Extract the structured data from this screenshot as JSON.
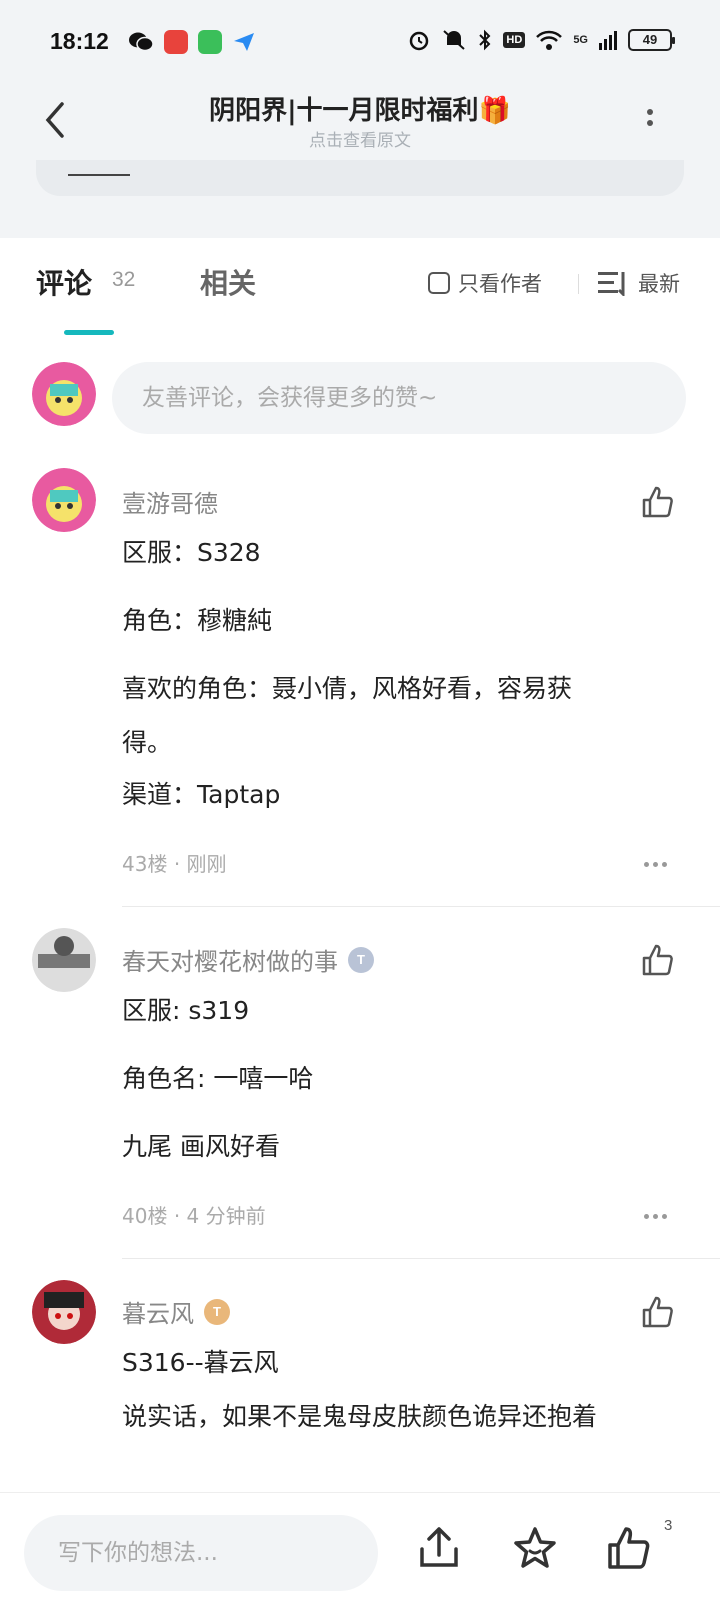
{
  "status_bar": {
    "time": "18:12",
    "battery": "49",
    "hd": "HD",
    "network": "5G"
  },
  "header": {
    "title": "阴阳界|十一月限时福利🎁",
    "subtitle": "点击查看原文"
  },
  "tabs": {
    "comments_label": "评论",
    "comments_count": "32",
    "related_label": "相关",
    "author_only_label": "只看作者",
    "sort_label": "最新"
  },
  "comment_input": {
    "placeholder": "友善评论，会获得更多的赞~"
  },
  "comments": [
    {
      "author": "壹游哥德",
      "lines": [
        "区服：S328",
        "角色：穆糖純",
        "喜欢的角色：聂小倩，风格好看，容易获",
        "得。",
        "渠道：Taptap"
      ],
      "floor": "43楼",
      "time": "刚刚"
    },
    {
      "author": "春天对樱花树做的事",
      "badge": "T",
      "lines": [
        "区服: s319",
        "角色名: 一嘻一哈",
        "九尾  画风好看"
      ],
      "floor": "40楼",
      "time": "4 分钟前"
    },
    {
      "author": "暮云风",
      "badge": "T",
      "lines": [
        "S316--暮云风",
        "说实话，如果不是鬼母皮肤颜色诡异还抱着"
      ]
    }
  ],
  "meta_separator": "·",
  "bottom_bar": {
    "placeholder": "写下你的想法...",
    "like_count": "3"
  },
  "colors": {
    "accent": "#15b8bd",
    "background_top": "#f2f4f6"
  }
}
